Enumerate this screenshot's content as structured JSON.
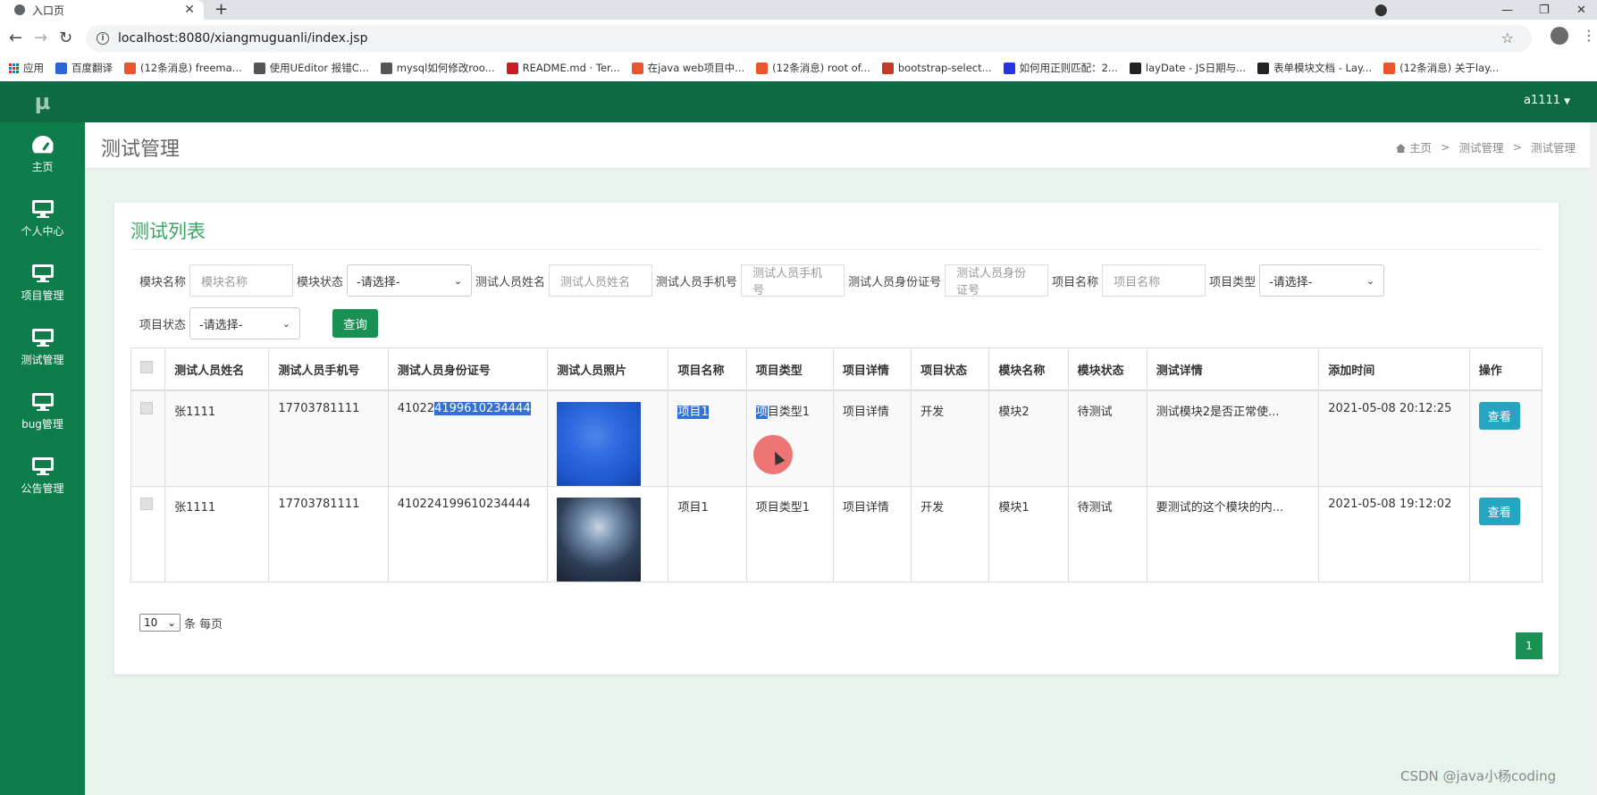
{
  "browser": {
    "tab_title": "入口页",
    "tab_close": "✕",
    "new_tab": "+",
    "window_controls": [
      "—",
      "❐",
      "✕"
    ],
    "url": "localhost:8080/xiangmuguanli/index.jsp",
    "bookmarks": [
      {
        "label": "应用",
        "icon": "apps-grid-icon",
        "color": "#1a73e8"
      },
      {
        "label": "百度翻译",
        "icon": "baidu-translate-icon",
        "color": "#2b63d9"
      },
      {
        "label": "(12条消息) freema...",
        "icon": "csdn-icon",
        "color": "#e8542c"
      },
      {
        "label": "使用UEditor 报错C...",
        "icon": "blog-icon",
        "color": "#555555"
      },
      {
        "label": "mysql如何修改roo...",
        "icon": "blog-icon",
        "color": "#555555"
      },
      {
        "label": "README.md · Ter...",
        "icon": "gitee-icon",
        "color": "#c71d23"
      },
      {
        "label": "在java web项目中...",
        "icon": "csdn-icon",
        "color": "#e8542c"
      },
      {
        "label": "(12条消息) root of...",
        "icon": "csdn-icon",
        "color": "#e8542c"
      },
      {
        "label": "bootstrap-select...",
        "icon": "doc-icon",
        "color": "#c0392b"
      },
      {
        "label": "如何用正则匹配：2...",
        "icon": "baidu-icon",
        "color": "#2932e1"
      },
      {
        "label": "layDate - JS日期与...",
        "icon": "layui-icon",
        "color": "#222222"
      },
      {
        "label": "表单模块文档 - Lay...",
        "icon": "layui-icon",
        "color": "#222222"
      },
      {
        "label": "(12条消息) 关于lay...",
        "icon": "csdn-icon",
        "color": "#e8542c"
      }
    ]
  },
  "app": {
    "logo": "μ",
    "user": "a1111",
    "sidebar": [
      {
        "label": "主页",
        "icon": "dashboard-icon"
      },
      {
        "label": "个人中心",
        "icon": "monitor-icon"
      },
      {
        "label": "项目管理",
        "icon": "monitor-icon"
      },
      {
        "label": "测试管理",
        "icon": "monitor-icon"
      },
      {
        "label": "bug管理",
        "icon": "monitor-icon"
      },
      {
        "label": "公告管理",
        "icon": "monitor-icon"
      }
    ],
    "page_title": "测试管理",
    "breadcrumb": [
      "主页",
      ">",
      "测试管理",
      ">",
      "测试管理"
    ]
  },
  "card": {
    "title": "测试列表",
    "filters": {
      "row1": [
        {
          "label": "模块名称",
          "type": "input",
          "placeholder": "模块名称"
        },
        {
          "label": "模块状态",
          "type": "select",
          "value": "-请选择-"
        },
        {
          "label": "测试人员姓名",
          "type": "input",
          "placeholder": "测试人员姓名"
        },
        {
          "label": "测试人员手机号",
          "type": "input",
          "placeholder": "测试人员手机号"
        },
        {
          "label": "测试人员身份证号",
          "type": "input",
          "placeholder": "测试人员身份证号"
        },
        {
          "label": "项目名称",
          "type": "input",
          "placeholder": "项目名称"
        },
        {
          "label": "项目类型",
          "type": "select",
          "value": "-请选择-"
        }
      ],
      "row2": [
        {
          "label": "项目状态",
          "type": "select",
          "value": "-请选择-"
        }
      ],
      "query_button": "查询"
    },
    "table": {
      "headers": [
        "测试人员姓名",
        "测试人员手机号",
        "测试人员身份证号",
        "测试人员照片",
        "项目名称",
        "项目类型",
        "项目详情",
        "项目状态",
        "模块名称",
        "模块状态",
        "测试详情",
        "添加时间",
        "操作"
      ],
      "rows": [
        {
          "name": "张1111",
          "phone": "17703781111",
          "id_pre": "41022",
          "id_sel": "4199610234444",
          "project": "项目1",
          "type_sel": "项",
          "type_rest": "目类型1",
          "detail": "项目详情",
          "status": "开发",
          "module": "模块2",
          "module_status": "待测试",
          "test_detail": "测试模块2是否正常使...",
          "time": "2021-05-08 20:12:25",
          "action": "查看"
        },
        {
          "name": "张1111",
          "phone": "17703781111",
          "id_pre": "410224199610234444",
          "id_sel": "",
          "project": "项目1",
          "type_sel": "",
          "type_rest": "项目类型1",
          "detail": "项目详情",
          "status": "开发",
          "module": "模块1",
          "module_status": "待测试",
          "test_detail": "要测试的这个模块的内...",
          "time": "2021-05-08 19:12:02",
          "action": "查看"
        }
      ]
    },
    "page_size": "10",
    "page_size_suffix": "条 每页",
    "current_page": "1"
  },
  "watermark": "CSDN @java小杨coding",
  "colors": {
    "sidebar": "#0f7c4c",
    "topbar": "#0e6a43",
    "accent": "#1a9154",
    "title": "#3aa466",
    "view_button": "#24a6c2",
    "selection": "#3271d6"
  }
}
